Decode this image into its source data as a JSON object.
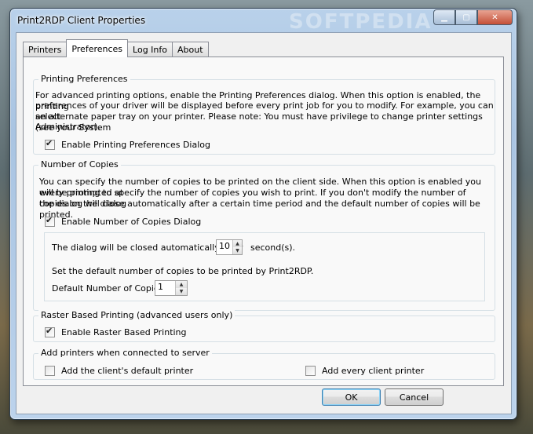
{
  "window": {
    "title": "Print2RDP Client  Properties",
    "watermark": "SOFTPEDIA"
  },
  "tabs": [
    {
      "label": "Printers"
    },
    {
      "label": "Preferences"
    },
    {
      "label": "Log Info"
    },
    {
      "label": "About"
    }
  ],
  "printing_prefs": {
    "legend": "Printing Preferences",
    "line1": "For advanced printing options, enable the Printing Preferences dialog. When this option is enabled, the printing",
    "line2": "preferences of your driver will be displayed before every print job for you to modify. For example, you can select",
    "line3": "an alternate paper tray on your printer. Please note: You must have privilege to change printer settings (see your System",
    "line4": "Administrator).",
    "checkbox_label": "Enable Printing Preferences Dialog",
    "checked": true
  },
  "copies": {
    "legend": "Number of Copies",
    "line1": "You can specify the number of copies to be printed on the client side. When this option is enabled you will be prompted at",
    "line2": "every printing to specify the number of copies you wish to print.  If you don't modify the number of copies on the dialog",
    "line3": "the dialog will close automatically after a certain time period and the default number of copies will be printed.",
    "checkbox_label": "Enable Number of Copies Dialog",
    "checked": true,
    "close_label": "The dialog will be closed automatically after",
    "close_value": "10",
    "close_unit": "second(s).",
    "default_desc": "Set the default number of copies to be printed by Print2RDP.",
    "default_label": "Default Number of Copies:",
    "default_value": "1"
  },
  "raster": {
    "legend": "Raster Based Printing (advanced users only)",
    "checkbox_label": "Enable Raster Based Printing",
    "checked": true
  },
  "add_printers": {
    "legend": "Add printers when connected to server",
    "default_label": "Add the client's default printer",
    "every_label": "Add every client printer"
  },
  "buttons": {
    "ok": "OK",
    "cancel": "Cancel"
  }
}
